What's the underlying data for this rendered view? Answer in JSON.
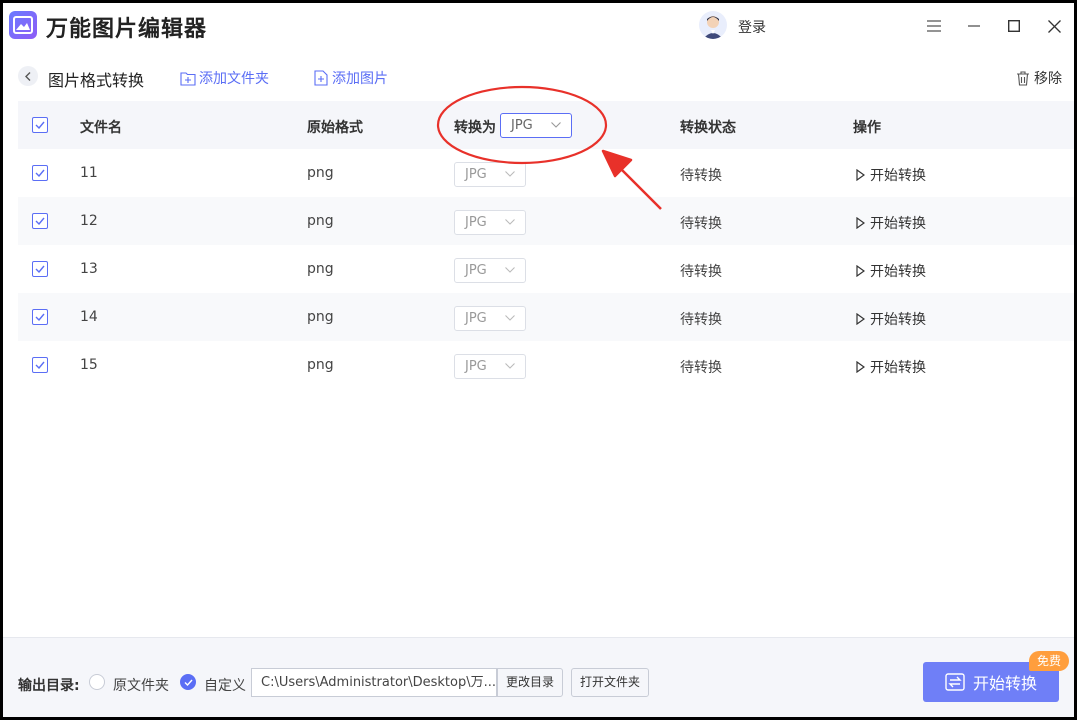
{
  "app": {
    "title": "万能图片编辑器",
    "login": "登录"
  },
  "toolbar": {
    "page_title": "图片格式转换",
    "add_folder": "添加文件夹",
    "add_image": "添加图片",
    "remove": "移除"
  },
  "table": {
    "headers": {
      "filename": "文件名",
      "original_format": "原始格式",
      "convert_to": "转换为",
      "convert_to_value": "JPG",
      "status": "转换状态",
      "action": "操作"
    },
    "rows": [
      {
        "name": "11",
        "format": "png",
        "target": "JPG",
        "status": "待转换",
        "action": "开始转换"
      },
      {
        "name": "12",
        "format": "png",
        "target": "JPG",
        "status": "待转换",
        "action": "开始转换"
      },
      {
        "name": "13",
        "format": "png",
        "target": "JPG",
        "status": "待转换",
        "action": "开始转换"
      },
      {
        "name": "14",
        "format": "png",
        "target": "JPG",
        "status": "待转换",
        "action": "开始转换"
      },
      {
        "name": "15",
        "format": "png",
        "target": "JPG",
        "status": "待转换",
        "action": "开始转换"
      }
    ]
  },
  "footer": {
    "output_label": "输出目录:",
    "option_original": "原文件夹",
    "option_custom": "自定义",
    "path": "C:\\Users\\Administrator\\Desktop\\万...",
    "change_dir": "更改目录",
    "open_folder": "打开文件夹",
    "start": "开始转换",
    "free_badge": "免费"
  },
  "colors": {
    "accent": "#5b6ef5",
    "start_button": "#6f7ff7",
    "badge": "#ff9e3d",
    "annotation": "#e8312a"
  }
}
